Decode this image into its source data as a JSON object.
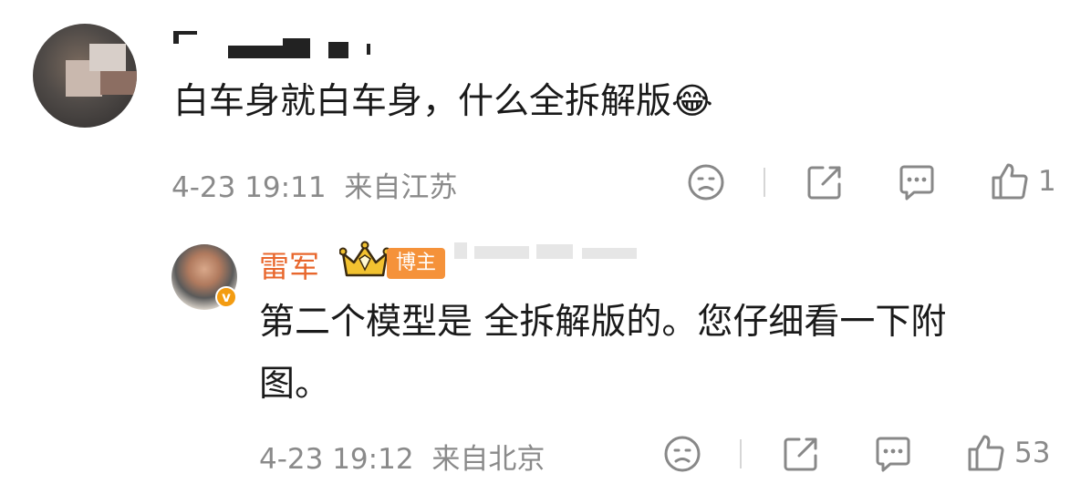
{
  "comment": {
    "text": "白车身就白车身，什么全拆解版😂",
    "timestamp": "4-23 19:11",
    "location": "来自江苏",
    "like_count": "1"
  },
  "reply": {
    "username": "雷军",
    "role_badge": "博主",
    "text_line1": "第二个模型是 全拆解版的。您仔细看一下附",
    "text_line2": "图。",
    "timestamp": "4-23 19:12",
    "location": "来自北京",
    "like_count": "53",
    "verified_mark": "v"
  },
  "colors": {
    "username_accent": "#e8672d",
    "badge_bg": "#f5923a",
    "meta_gray": "#8a8a8a"
  },
  "icons": [
    "sad-face-icon",
    "share-icon",
    "comment-icon",
    "like-icon",
    "crown-icon"
  ]
}
